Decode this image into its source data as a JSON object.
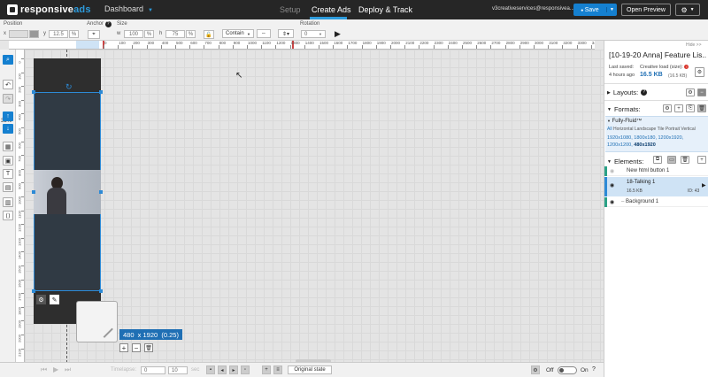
{
  "nav": {
    "logo_a": "responsive",
    "logo_b": "ads",
    "dashboard": "Dashboard",
    "setup": "Setup",
    "create": "Create Ads",
    "deploy": "Deploy & Track",
    "user": "v3creativeservices@responsivea...",
    "save": "Save",
    "preview": "Open Preview"
  },
  "toolbar": {
    "position_label": "Position",
    "x_label": "x",
    "x_value": "",
    "y_label": "y",
    "y_value": "12.5",
    "percent": "%",
    "anchor_label": "Anchor",
    "size_label": "Size",
    "w_label": "w",
    "w_value": "100",
    "h_label": "h",
    "h_value": "75",
    "fit_value": "Contain",
    "rotation_label": "Rotation",
    "rotation_value": "0"
  },
  "ruler": {
    "h_ticks": [
      "0",
      "100",
      "200",
      "300",
      "400",
      "500",
      "600",
      "700",
      "800",
      "900",
      "1000",
      "1100",
      "1200",
      "1300",
      "1400",
      "1500",
      "1600",
      "1700",
      "1800",
      "1900",
      "2000",
      "2100",
      "2200",
      "2300",
      "2400",
      "2500",
      "2600",
      "2700",
      "2800",
      "2900",
      "3000",
      "3100",
      "3200",
      "3300",
      "3400",
      "3500",
      "3600",
      "3700",
      "3800",
      "3900"
    ],
    "v_ticks": [
      "0",
      "100",
      "200",
      "300",
      "400",
      "500",
      "600",
      "700",
      "800",
      "900",
      "1000",
      "1100",
      "1200",
      "1300",
      "1400",
      "1500",
      "1600",
      "1700",
      "1800",
      "1900",
      "2000",
      "2100",
      "2200",
      "2300",
      "2400"
    ]
  },
  "lefttools": {
    "zoom": "33%"
  },
  "canvas": {
    "size_label": "480  x 1920  (0.25)"
  },
  "panel": {
    "hide": "Hide >>",
    "title": "[10-19-20 Anna] Feature Lis...",
    "last_saved_label": "Last saved:",
    "last_saved_value": "4 hours ago",
    "load_label": "Creative load (size):",
    "load_value": "16.5 KB",
    "load_value_paren": "(16.5 KB)",
    "layouts": "Layouts:",
    "formats": "Formats:",
    "fully_fluid": "Fully-Fluid™",
    "format_all": "All",
    "format_types": "Horizontal Landscape Tile Portrait Vertical",
    "format_sizes": "1920x1080, 1800x180, 1200x1920, 1200x1200,",
    "format_active": "480x1920",
    "elements": "Elements:",
    "el1_name": "New html button 1",
    "el2_name": "18-Talking 1",
    "el2_size": "16.5 KB",
    "el2_id": "ID: 43",
    "el3_name": "Background 1"
  },
  "bottom": {
    "timelapse_label": "Timelapse:",
    "timelapse_value": "0",
    "sec_value": "10",
    "sec_label": "sec",
    "original_state": "Original state",
    "off": "Off",
    "on": "On"
  },
  "colors": {
    "accent": "#1580d0",
    "nav_bg": "#262626",
    "selection": "#2d8ad6"
  }
}
